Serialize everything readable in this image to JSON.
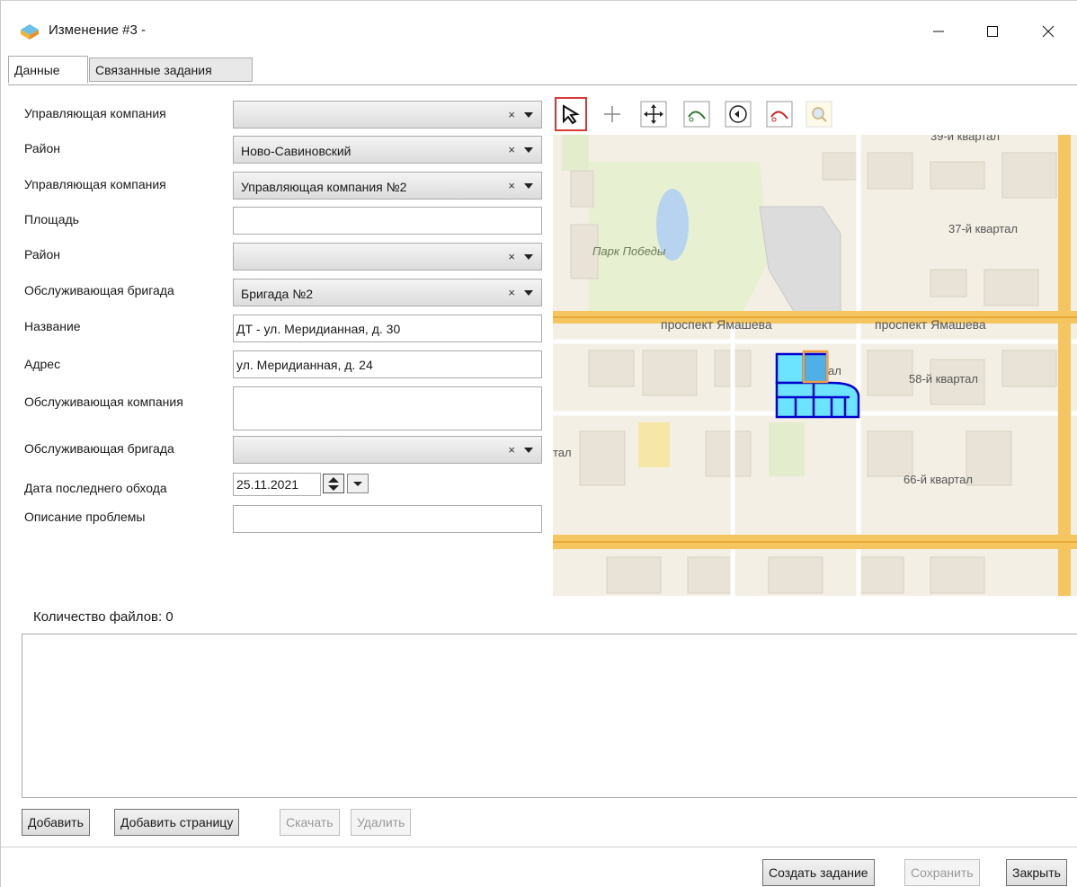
{
  "window": {
    "title": "Изменение #3 -",
    "controls": {
      "minimize": "—",
      "maximize": "☐",
      "close": "✕"
    }
  },
  "tabs": [
    {
      "label": "Данные",
      "active": true
    },
    {
      "label": "Связанные задания",
      "active": false
    }
  ],
  "form": {
    "fields": [
      {
        "label": "Управляющая компания",
        "type": "combo",
        "value": ""
      },
      {
        "label": "Район",
        "type": "combo",
        "value": "Ново-Савиновский"
      },
      {
        "label": "Управляющая компания",
        "type": "combo",
        "value": "Управляющая компания №2"
      },
      {
        "label": "Площадь",
        "type": "text",
        "value": ""
      },
      {
        "label": "Район",
        "type": "combo",
        "value": ""
      },
      {
        "label": "Обслуживающая бригада",
        "type": "combo",
        "value": "Бригада №2"
      },
      {
        "label": "Название",
        "type": "text",
        "value": "ДТ - ул. Меридианная, д. 30"
      },
      {
        "label": "Адрес",
        "type": "text",
        "value": "ул. Меридианная, д. 24"
      },
      {
        "label": "Обслуживающая компания",
        "type": "text",
        "value": ""
      },
      {
        "label": "Обслуживающая бригада",
        "type": "combo",
        "value": ""
      },
      {
        "label": "Дата последнего обхода",
        "type": "date",
        "value": "25.11.2021"
      },
      {
        "label": "Описание проблемы",
        "type": "text",
        "value": ""
      }
    ],
    "clear_glyph": "×"
  },
  "map": {
    "tools": [
      "select-arrow-icon",
      "add-point-icon",
      "pan-move-icon",
      "draw-arc-icon",
      "rotate-icon",
      "delete-arc-icon",
      "zoom-icon"
    ],
    "labels": {
      "kvartal_top": "39-й квартал",
      "kvartal_37": "37-й квартал",
      "park": "Парк Победы",
      "prospekt_left": "проспект Ямашева",
      "prospekt_right": "проспект Ямашева",
      "kvartal_58": "58-й квартал",
      "kvartal_66": "66-й квартал",
      "tal": "тал",
      "al": "ал"
    },
    "colors": {
      "selected_fill": "#6de4ff",
      "selected_outline": "#0000cc",
      "highlight": "#f0a040",
      "road": "#f5c560"
    }
  },
  "files": {
    "count_label": "Количество файлов: 0"
  },
  "file_buttons": {
    "add": "Добавить",
    "add_page": "Добавить страницу",
    "download": "Скачать",
    "delete": "Удалить"
  },
  "footer": {
    "create_task": "Создать задание",
    "save": "Сохранить",
    "close": "Закрыть"
  }
}
